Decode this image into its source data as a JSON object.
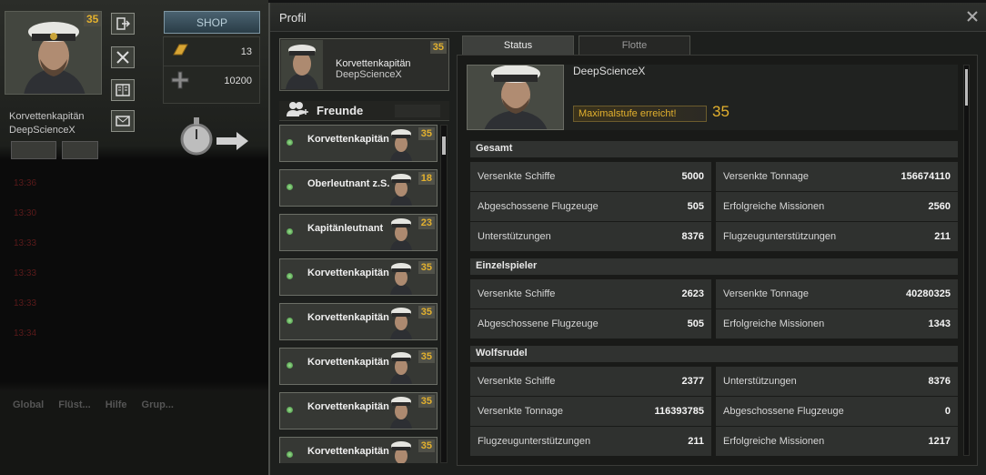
{
  "hud": {
    "player_level": "35",
    "player_rank": "Korvettenkapitän",
    "player_name": "DeepScienceX",
    "shop_label": "SHOP",
    "gold_value": "13",
    "iron_value": "10200",
    "chat_times": [
      "13:36",
      "13:30",
      "13:33",
      "13:33",
      "13:34"
    ],
    "chat_tabs": [
      "Global",
      "Flüst...",
      "Hilfe",
      "Grup..."
    ]
  },
  "dialog": {
    "title": "Profil",
    "profile": {
      "rank": "Korvettenkapitän",
      "name": "DeepScienceX",
      "level": "35"
    },
    "friends_label": "Freunde",
    "friends": [
      {
        "rank": "Korvettenkapitän",
        "level": "35"
      },
      {
        "rank": "Oberleutnant z.S.",
        "level": "18"
      },
      {
        "rank": "Kapitänleutnant",
        "level": "23"
      },
      {
        "rank": "Korvettenkapitän",
        "level": "35"
      },
      {
        "rank": "Korvettenkapitän",
        "level": "35"
      },
      {
        "rank": "Korvettenkapitän",
        "level": "35"
      },
      {
        "rank": "Korvettenkapitän",
        "level": "35"
      },
      {
        "rank": "Korvettenkapitän",
        "level": "35"
      }
    ],
    "tabs": [
      "Status",
      "Flotte"
    ],
    "status": {
      "name": "DeepScienceX",
      "max_level_label": "Maximalstufe erreicht!",
      "level": "35",
      "sections": [
        {
          "title": "Gesamt",
          "rows": [
            [
              "Versenkte Schiffe",
              "5000",
              "Versenkte Tonnage",
              "156674110"
            ],
            [
              "Abgeschossene Flugzeuge",
              "505",
              "Erfolgreiche Missionen",
              "2560"
            ],
            [
              "Unterstützungen",
              "8376",
              "Flugzeugunterstützungen",
              "211"
            ]
          ]
        },
        {
          "title": "Einzelspieler",
          "rows": [
            [
              "Versenkte Schiffe",
              "2623",
              "Versenkte Tonnage",
              "40280325"
            ],
            [
              "Abgeschossene Flugzeuge",
              "505",
              "Erfolgreiche Missionen",
              "1343"
            ]
          ]
        },
        {
          "title": "Wolfsrudel",
          "rows": [
            [
              "Versenkte Schiffe",
              "2377",
              "Unterstützungen",
              "8376"
            ],
            [
              "Versenkte Tonnage",
              "116393785",
              "Abgeschossene Flugzeuge",
              "0"
            ],
            [
              "Flugzeugunterstützungen",
              "211",
              "Erfolgreiche Missionen",
              "1217"
            ]
          ]
        }
      ]
    }
  },
  "colors": {
    "accent_gold": "#e3b12e",
    "online_green": "#5fb456"
  },
  "icons": [
    "logout-icon",
    "tools-icon",
    "book-icon",
    "mail-icon",
    "gold-bar-icon",
    "iron-cross-icon",
    "stopwatch-icon",
    "arrow-right-icon",
    "friends-icon",
    "close-icon"
  ]
}
